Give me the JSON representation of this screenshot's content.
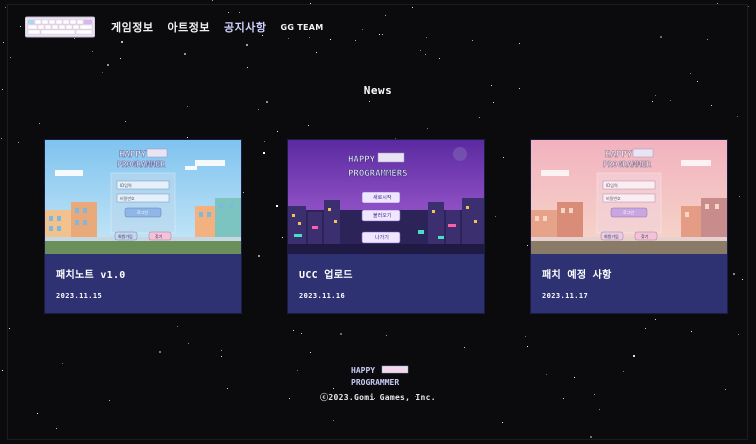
{
  "nav": {
    "items": [
      {
        "label": "게임정보"
      },
      {
        "label": "아트정보"
      },
      {
        "label": "공지사항"
      },
      {
        "label": "GG TEAM"
      }
    ]
  },
  "section": {
    "title": "News"
  },
  "thumbs": {
    "happy": "HAPPY",
    "programmer": "PROGRAMMER",
    "programmers": "PROGRAMMERS",
    "id_placeholder": "ID입력",
    "pw_placeholder": "비밀번호",
    "login": "로그인",
    "signup": "회원가입",
    "find": "찾기",
    "menu": [
      "새로시작",
      "불러오기",
      "나가기"
    ]
  },
  "cards": [
    {
      "title": "패치노트 v1.0",
      "date": "2023.11.15"
    },
    {
      "title": "UCC 업로드",
      "date": "2023.11.16"
    },
    {
      "title": "패치 예정 사항",
      "date": "2023.11.17"
    }
  ],
  "footer": {
    "happy": "HAPPY",
    "programmer": "PROGRAMMER",
    "copyright": "ⓒ2023.Gomi Games, Inc."
  },
  "colors": {
    "card_bg": "#2e3272",
    "page_bg": "#0b0b0d",
    "accent": "#cfd2ff"
  }
}
